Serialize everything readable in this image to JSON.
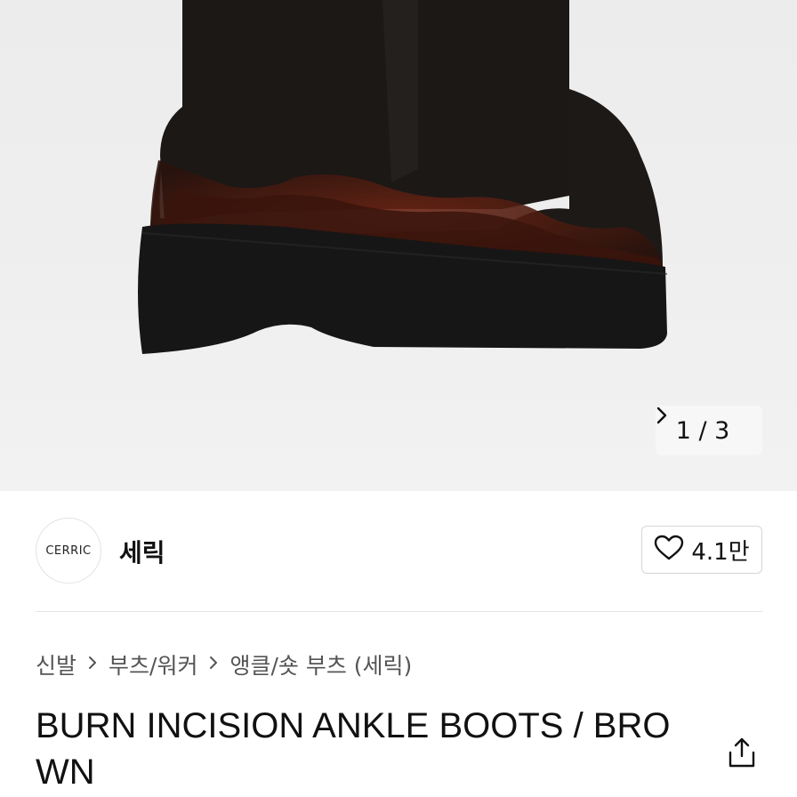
{
  "gallery": {
    "pager_text": "1 / 3",
    "next_icon": "chevron-right-icon"
  },
  "brand": {
    "logo_text": "CERRIC",
    "name": "세릭",
    "like_icon": "heart-icon",
    "like_count": "4.1만"
  },
  "breadcrumb": {
    "items": [
      "신발",
      "부츠/워커",
      "앵클/숏 부츠 (세릭)"
    ],
    "separator_icon": "chevron-right-icon"
  },
  "product": {
    "title": "BURN INCISION ANKLE BOOTS / BROWN",
    "share_icon": "share-icon"
  },
  "colors": {
    "boot_leather": "#1b1816",
    "burn_accent": "#5a1f12",
    "sole": "#161616"
  }
}
